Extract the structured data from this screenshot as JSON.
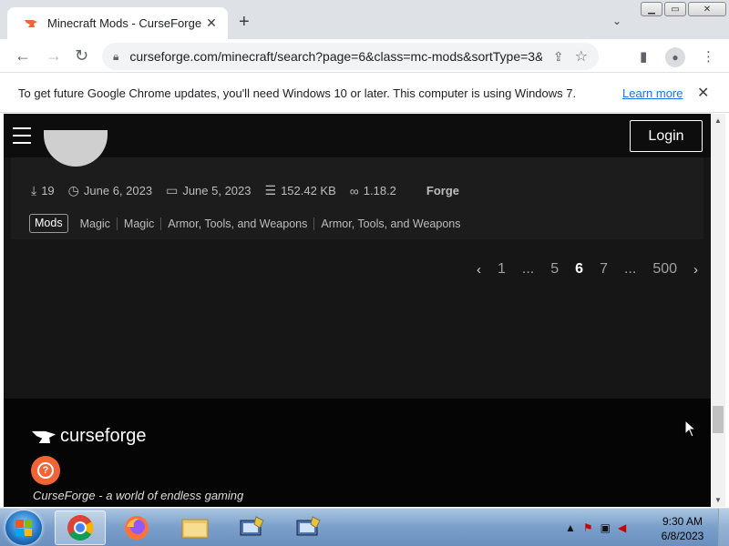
{
  "browser": {
    "tab_title": "Minecraft Mods - CurseForge",
    "tab_close": "✕",
    "new_tab": "+",
    "tab_search": "⌄",
    "url": "curseforge.com/minecraft/search?page=6&class=mc-mods&sortType=3&...",
    "window_buttons": {
      "minimize": "▁",
      "maximize": "▭",
      "close": "✕"
    }
  },
  "infobar": {
    "message": "To get future Google Chrome updates, you'll need Windows 10 or later. This computer is using Windows 7.",
    "link": "Learn more",
    "close": "✕"
  },
  "site": {
    "login_label": "Login",
    "card": {
      "downloads": "19",
      "updated": "June 6, 2023",
      "created": "June 5, 2023",
      "size": "152.42 KB",
      "game_version": "1.18.2",
      "loader": "Forge",
      "primary_tag": "Mods",
      "tags": [
        "Magic",
        "Magic",
        "Armor, Tools, and Weapons",
        "Armor, Tools, and Weapons"
      ]
    },
    "pagination": {
      "prev": "‹",
      "pages": [
        "1",
        "...",
        "5",
        "6",
        "7",
        "...",
        "500"
      ],
      "current": "6",
      "next": "›"
    },
    "footer": {
      "brand": "curseforge",
      "help": "?",
      "tagline": "CurseForge - a world of endless gaming"
    }
  },
  "taskbar": {
    "time": "9:30 AM",
    "date": "6/8/2023"
  },
  "colors": {
    "accent_orange": "#f16436",
    "page_bg": "#161616",
    "card_bg": "#1c1c1c"
  }
}
